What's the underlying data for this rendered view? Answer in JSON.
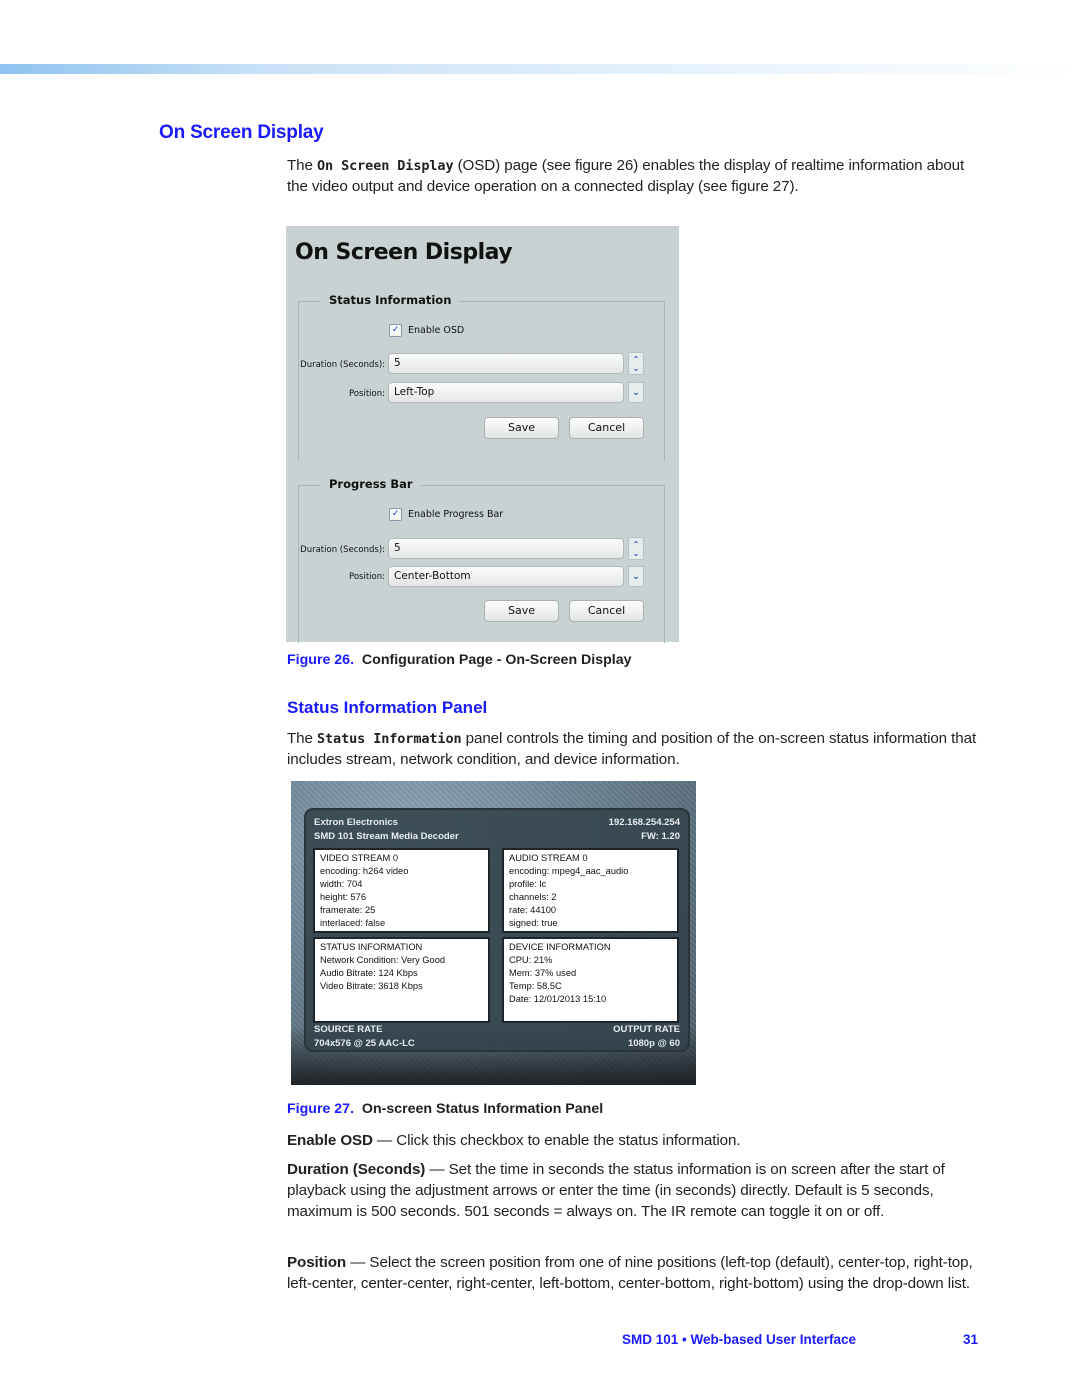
{
  "section": {
    "title": "On Screen Display",
    "intro": {
      "prefix": "The ",
      "code": "On Screen Display",
      "suffix": " (OSD) page (see figure 26) enables the display of realtime information about the video output and device operation on a connected display (see figure 27)."
    }
  },
  "figure26": {
    "number": "Figure 26.",
    "caption": "Configuration Page - On-Screen Display",
    "page_title": "On Screen Display",
    "status_group": {
      "title": "Status Information",
      "checkbox_label": "Enable OSD",
      "checked": true,
      "duration_label": "Duration (Seconds):",
      "duration_value": "5",
      "position_label": "Position:",
      "position_value": "Left-Top",
      "save_label": "Save",
      "cancel_label": "Cancel"
    },
    "progress_group": {
      "title": "Progress Bar",
      "checkbox_label": "Enable Progress Bar",
      "checked": true,
      "duration_label": "Duration (Seconds):",
      "duration_value": "5",
      "position_label": "Position:",
      "position_value": "Center-Bottom",
      "save_label": "Save",
      "cancel_label": "Cancel"
    },
    "icons": {
      "checkmark": "✓",
      "spin_up": "⌃",
      "spin_down": "⌄",
      "dropdown": "⌄"
    }
  },
  "subsection": {
    "title": "Status Information Panel",
    "intro": {
      "prefix": "The ",
      "code": "Status Information",
      "suffix": " panel controls the timing and position of the on-screen status information that includes stream, network condition, and device information."
    }
  },
  "figure27": {
    "number": "Figure 27.",
    "caption": "On-screen Status Information Panel",
    "header": {
      "company": "Extron Electronics",
      "device": "SMD 101 Stream Media Decoder",
      "ip": "192.168.254.254",
      "fw": "FW: 1.20"
    },
    "video_stream": [
      "VIDEO STREAM 0",
      "encoding: h264 video",
      "width: 704",
      "height: 576",
      "framerate: 25",
      "interlaced: false"
    ],
    "audio_stream": [
      "AUDIO STREAM 0",
      "encoding: mpeg4_aac_audio",
      "profile: lc",
      "channels: 2",
      "rate: 44100",
      "signed: true"
    ],
    "status_info": [
      "STATUS INFORMATION",
      "Network Condition: Very Good",
      "Audio Bitrate: 124 Kbps",
      "Video Bitrate: 3618 Kbps"
    ],
    "device_info": [
      "DEVICE INFORMATION",
      "CPU: 21%",
      "Mem: 37% used",
      "Temp: 58.5C",
      "Date: 12/01/2013 15:10"
    ],
    "source_rate_label": "SOURCE RATE",
    "source_rate_value": "704x576 @ 25 AAC-LC",
    "output_rate_label": "OUTPUT RATE",
    "output_rate_value": "1080p @ 60"
  },
  "definitions": [
    {
      "term": "Enable OSD",
      "text": " — Click this checkbox to enable the status information."
    },
    {
      "term": "Duration (Seconds)",
      "text": " — Set the time in seconds the status information is on screen after the start of playback using the adjustment arrows or enter the time (in seconds) directly. Default is 5 seconds, maximum is 500 seconds. 501 seconds = always on. The IR remote can toggle it on or off."
    },
    {
      "term": "Position",
      "text": " — Select the screen position from one of nine positions (left-top (default), center-top, right-top, left-center, center-center, right-center, left-bottom, center-bottom, right-bottom) using the drop-down list."
    }
  ],
  "footer": {
    "text": "SMD 101 • Web-based User Interface",
    "page_number": "31"
  }
}
